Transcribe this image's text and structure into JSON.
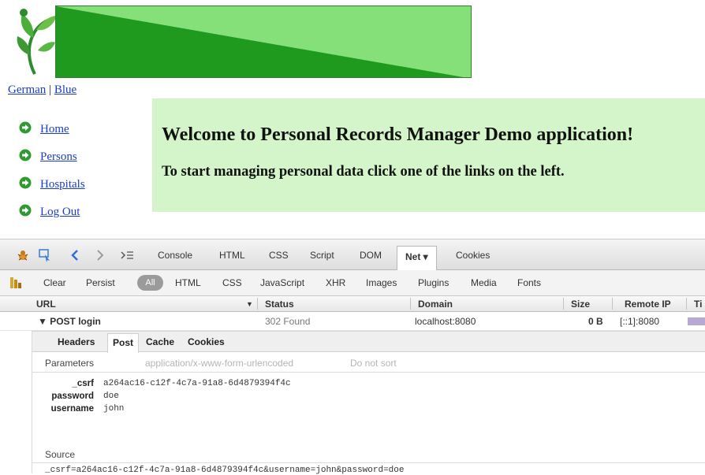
{
  "page": {
    "lang_links": [
      "German",
      "Blue"
    ],
    "lang_separator": "|",
    "nav": [
      "Home",
      "Persons",
      "Hospitals",
      "Log Out"
    ],
    "welcome_title": "Welcome to Personal Records Manager Demo application!",
    "welcome_subtitle": "To start managing personal data click one of the links on the left."
  },
  "firebug": {
    "tabs": [
      "Console",
      "HTML",
      "CSS",
      "Script",
      "DOM",
      "Net ▾",
      "Cookies"
    ],
    "filters": [
      "Clear",
      "Persist",
      "All",
      "HTML",
      "CSS",
      "JavaScript",
      "XHR",
      "Images",
      "Plugins",
      "Media",
      "Fonts"
    ],
    "columns": [
      "URL",
      "Status",
      "Domain",
      "Size",
      "Remote IP",
      "Ti"
    ],
    "request": {
      "url": "▼ POST login",
      "status": "302 Found",
      "domain": "localhost:8080",
      "size": "0 B",
      "remote_ip": "[::1]:8080"
    },
    "detail_tabs": [
      "Headers",
      "Post",
      "Cache",
      "Cookies"
    ],
    "params_label": "Parameters",
    "encoding": "application/x-www-form-urlencoded",
    "sort_label": "Do not sort",
    "params": [
      {
        "key": "_csrf",
        "value": "a264ac16-c12f-4c7a-91a8-6d4879394f4c"
      },
      {
        "key": "password",
        "value": "doe"
      },
      {
        "key": "username",
        "value": "john"
      }
    ],
    "source_label": "Source",
    "source": "_csrf=a264ac16-c12f-4c7a-91a8-6d4879394f4c&username=john&password=doe"
  },
  "colors": {
    "banner_dark": "#1f9a1f",
    "banner_light": "#86e07a",
    "welcome_bg": "#d4f5c9",
    "link": "#1a3cc8"
  }
}
